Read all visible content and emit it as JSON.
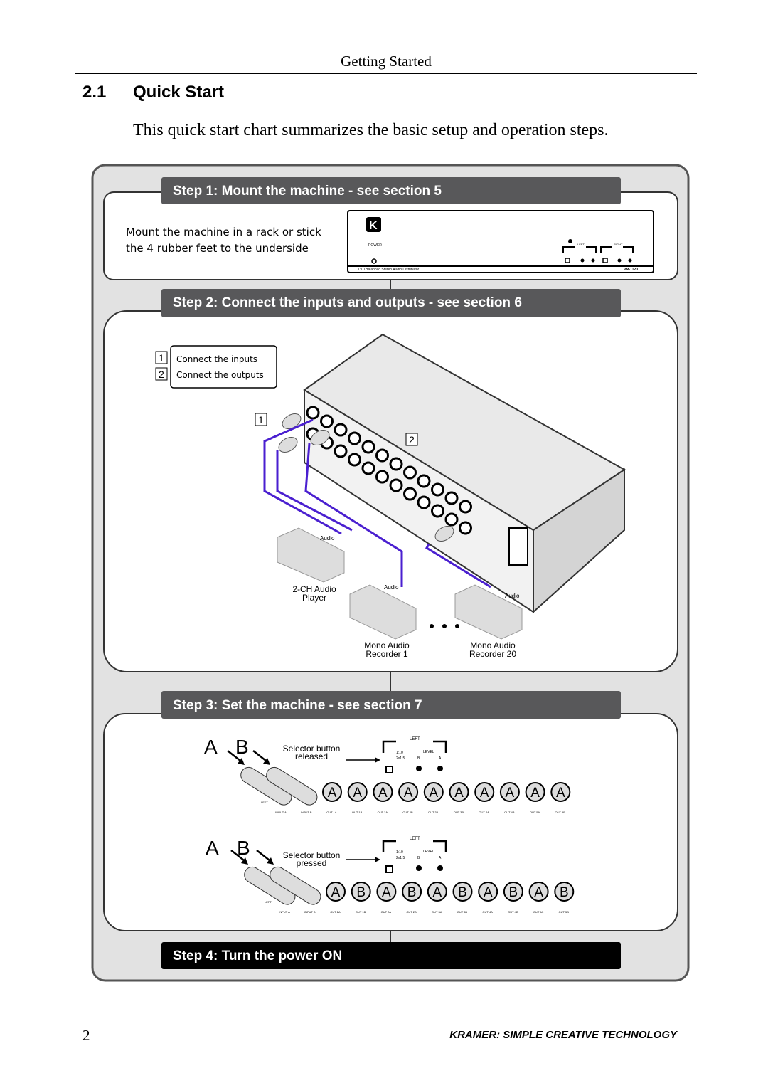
{
  "header": {
    "running_title": "Getting Started"
  },
  "section": {
    "number": "2.1",
    "title": "Quick Start",
    "intro": "This quick start chart summarizes the basic setup and operation steps."
  },
  "steps": [
    {
      "title": "Step 1: Mount the machine - see section 5",
      "text_line1": "Mount the machine in a rack or stick",
      "text_line2": "the 4 rubber feet to the underside"
    },
    {
      "title": "Step 2: Connect the inputs and outputs - see section 6",
      "legend": [
        {
          "num": "1",
          "label": "Connect the inputs"
        },
        {
          "num": "2",
          "label": "Connect the outputs"
        }
      ]
    },
    {
      "title": "Step 3: Set the machine - see section 7"
    },
    {
      "title": "Step 4: Turn the power ON"
    }
  ],
  "device_front": {
    "power_label": "POWER",
    "model_desc": "1:10 Balanced Stereo Audio Distributor",
    "model": "VM-1120",
    "left_label": "LEFT",
    "right_label": "RIGHT",
    "level_label": "LEVEL",
    "mode1": "1:10",
    "mode2": "2x1:5",
    "b": "B",
    "a": "A"
  },
  "step2_diagram": {
    "callout1": "1",
    "callout2": "2",
    "player_tag": "Audio",
    "player_label1": "2-CH Audio",
    "player_label2": "Player",
    "rec1_tag": "Audio",
    "rec1_label1": "Mono Audio",
    "rec1_label2": "Recorder 1",
    "rec20_tag": "Audio",
    "rec20_label1": "Mono Audio",
    "rec20_label2": "Recorder 20"
  },
  "step3_diagram": {
    "input_a": "A",
    "input_b": "B",
    "released_label1": "Selector button",
    "released_label2": "released",
    "pressed_label1": "Selector button",
    "pressed_label2": "pressed",
    "left_label": "LEFT",
    "level_label": "LEVEL",
    "mode1": "1:10",
    "mode2": "2x1:5",
    "b": "B",
    "a": "A",
    "connector_labels": [
      "INPUT A",
      "INPUT B",
      "OUT 1A",
      "OUT 1B",
      "OUT 2A",
      "OUT 2B",
      "OUT 3A",
      "OUT 3B",
      "OUT 4A",
      "OUT 4B",
      "OUT 5A",
      "OUT 5B"
    ],
    "released_outputs": [
      "A",
      "A",
      "A",
      "A",
      "A",
      "A",
      "A",
      "A",
      "A",
      "A"
    ],
    "pressed_outputs": [
      "A",
      "B",
      "A",
      "B",
      "A",
      "B",
      "A",
      "B",
      "A",
      "B"
    ]
  },
  "colors": {
    "cable": "#4a1fd0",
    "step_bar": "#58585a",
    "step4_bar": "#000000",
    "frame_fill": "#e2e2e2"
  },
  "footer": {
    "page_number": "2",
    "brand": "KRAMER:  SIMPLE CREATIVE TECHNOLOGY"
  }
}
